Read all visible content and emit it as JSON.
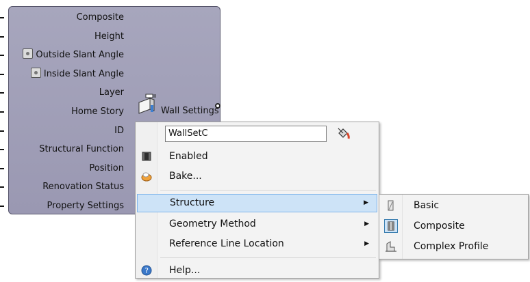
{
  "component": {
    "inputs": [
      {
        "label": "Composite",
        "toggle": false,
        "tick": true
      },
      {
        "label": "Height",
        "toggle": false,
        "tick": true
      },
      {
        "label": "Outside Slant Angle",
        "toggle": true,
        "tick": false
      },
      {
        "label": "Inside Slant Angle",
        "toggle": true,
        "tick": false
      },
      {
        "label": "Layer",
        "toggle": false,
        "tick": true
      },
      {
        "label": "Home Story",
        "toggle": false,
        "tick": true
      },
      {
        "label": "ID",
        "toggle": false,
        "tick": true
      },
      {
        "label": "Structural Function",
        "toggle": false,
        "tick": true
      },
      {
        "label": "Position",
        "toggle": false,
        "tick": true
      },
      {
        "label": "Renovation Status",
        "toggle": false,
        "tick": true
      },
      {
        "label": "Property Settings",
        "toggle": false,
        "tick": true
      }
    ],
    "output_label": "Wall Settings",
    "icon": "wall-settings-icon",
    "colors": {
      "body": "#a7a6bd",
      "border": "#55546a"
    }
  },
  "menu": {
    "name_value": "WallSetC",
    "paint_icon": "paint-bucket-icon",
    "items": [
      {
        "label": "Enabled",
        "icon": "enabled-icon",
        "has_submenu": false
      },
      {
        "label": "Bake...",
        "icon": "bake-icon",
        "has_submenu": false
      },
      {
        "label": "Structure",
        "icon": "",
        "has_submenu": true,
        "highlighted": true
      },
      {
        "label": "Geometry Method",
        "icon": "",
        "has_submenu": true
      },
      {
        "label": "Reference Line Location",
        "icon": "",
        "has_submenu": true
      },
      {
        "label": "Help...",
        "icon": "help-icon",
        "has_submenu": false
      }
    ],
    "arrow_glyph": "▶",
    "highlight_color": "#cde3f7"
  },
  "submenu": {
    "items": [
      {
        "label": "Basic",
        "icon": "basic-structure-icon",
        "checked": false
      },
      {
        "label": "Composite",
        "icon": "composite-structure-icon",
        "checked": true
      },
      {
        "label": "Complex Profile",
        "icon": "complex-profile-icon",
        "checked": false
      }
    ]
  }
}
